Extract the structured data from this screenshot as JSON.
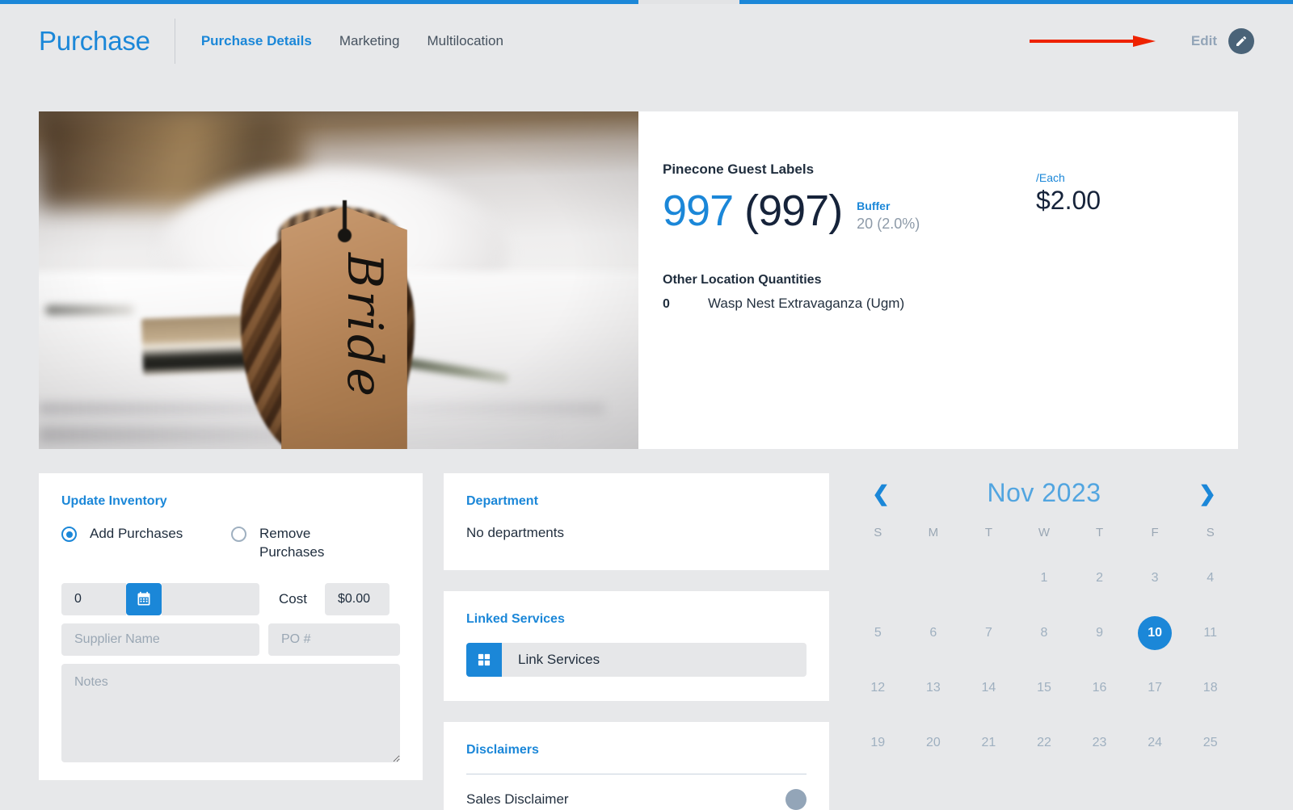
{
  "header": {
    "brand": "Purchase",
    "tabs": [
      {
        "label": "Purchase Details",
        "active": true
      },
      {
        "label": "Marketing",
        "active": false
      },
      {
        "label": "Multilocation",
        "active": false
      }
    ],
    "edit_label": "Edit",
    "edit_icon": "pencil-icon"
  },
  "product": {
    "name": "Pinecone Guest Labels",
    "qty_on_hand": "997",
    "qty_available": "(997)",
    "buffer_label": "Buffer",
    "buffer_value": "20 (2.0%)",
    "price_unit": "/Each",
    "price": "$2.00",
    "other_locations_title": "Other Location Quantities",
    "other_locations": [
      {
        "qty": "0",
        "location": "Wasp Nest Extravaganza (Ugm)"
      }
    ],
    "photo_alt": "Kraft paper Bride place card tag on a pinecone over white linen"
  },
  "update_inventory": {
    "title": "Update Inventory",
    "mode_options": [
      {
        "label": "Add Purchases",
        "selected": true
      },
      {
        "label": "Remove Purchases",
        "selected": false
      }
    ],
    "quantity_value": "0",
    "calendar_icon": "calendar-icon",
    "date_placeholder": "",
    "date_value": "",
    "cost_label": "Cost",
    "cost_value": "$0.00",
    "supplier_placeholder": "Supplier Name",
    "supplier_value": "",
    "po_placeholder": "PO #",
    "po_value": "",
    "notes_placeholder": "Notes",
    "notes_value": ""
  },
  "department": {
    "title": "Department",
    "empty_text": "No departments"
  },
  "linked_services": {
    "title": "Linked Services",
    "button_label": "Link Services",
    "button_icon": "grid-icon"
  },
  "disclaimers": {
    "title": "Disclaimers",
    "items": [
      {
        "name": "Sales Disclaimer",
        "toggle": "toggle-off"
      }
    ]
  },
  "calendar": {
    "prev_icon": "chevron-left-icon",
    "next_icon": "chevron-right-icon",
    "month_label": "Nov 2023",
    "day_headers": [
      "S",
      "M",
      "T",
      "W",
      "T",
      "F",
      "S"
    ],
    "leading_blanks": 3,
    "days": [
      1,
      2,
      3,
      4,
      5,
      6,
      7,
      8,
      9,
      10,
      11,
      12,
      13,
      14,
      15,
      16,
      17,
      18,
      19,
      20,
      21,
      22,
      23,
      24,
      25
    ],
    "selected_day": 10
  },
  "colors": {
    "accent": "#1b87d8",
    "page_bg": "#e7e8ea",
    "card_bg": "#ffffff",
    "text_dark": "#1f2d3d",
    "muted": "#9aa7b4",
    "annotation_red": "#ee2200"
  }
}
